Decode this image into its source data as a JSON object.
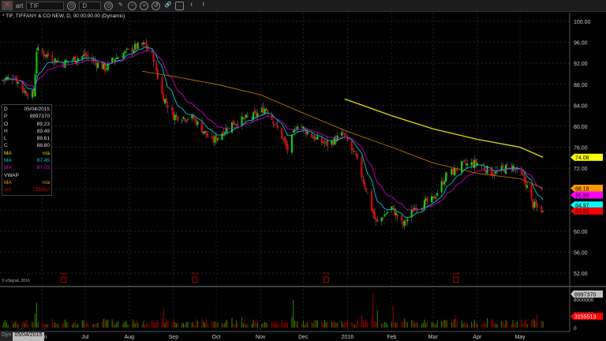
{
  "toolbar": {
    "close_icon": "close-x-icon",
    "label": "art",
    "symbol": "TIF",
    "interval": "D",
    "icons": [
      "clock-icon",
      "clock-icon",
      "pencil-icon",
      "zoom-out-icon",
      "zoom-in-icon",
      "reset-icon",
      "link-icon",
      "square-icon",
      "twitter-icon",
      "facebook-icon"
    ]
  },
  "title": "* TIF, TIFFANY & CO NEW, D, 00:00:00.00 (Dynamic)",
  "infobox": [
    {
      "k": "D",
      "v": "05/04/2015",
      "color": "#dddddd"
    },
    {
      "k": "P",
      "v": "8997370",
      "color": "#dddddd"
    },
    {
      "k": "O",
      "v": "89.23",
      "color": "#dddddd"
    },
    {
      "k": "H",
      "v": "89.49",
      "color": "#dddddd"
    },
    {
      "k": "L",
      "v": "88.61",
      "color": "#dddddd"
    },
    {
      "k": "C",
      "v": "88.80",
      "color": "#dddddd"
    },
    {
      "k": "MA",
      "v": "n/a",
      "color": "#e0e000"
    },
    {
      "k": "MA",
      "v": "87.45",
      "color": "#00d0d0"
    },
    {
      "k": "MA",
      "v": "87.03",
      "color": "#e000e0"
    },
    {
      "k": "VWAP",
      "v": "",
      "color": "#dddddd"
    },
    {
      "k": "MA",
      "v": "n/a",
      "color": "#ff9900"
    },
    {
      "k": "Vol",
      "v": "795662",
      "color": "#cc0000"
    }
  ],
  "copyright": "© eSignal, 2016",
  "colors": {
    "up": "#00dd00",
    "down": "#ee0000",
    "ma_fast": "#00c8c8",
    "ma_mid": "#c000c0",
    "ma_slow": "#b86e00",
    "ma_long": "#e0e000"
  },
  "chart_data": {
    "type": "candlestick",
    "ylim": [
      50,
      101
    ],
    "y_ticks": [
      "100.00",
      "96.00",
      "92.00",
      "88.00",
      "84.00",
      "80.00",
      "76.00",
      "72.00",
      "68.00",
      "64.00",
      "60.00",
      "56.00",
      "52.00"
    ],
    "x_ticks": [
      "Jun",
      "Jul",
      "Aug",
      "Sep",
      "Oct",
      "Nov",
      "Dec",
      "2016",
      "Feb",
      "Mar",
      "Apr",
      "May"
    ],
    "start": "2015-05-04",
    "end": "2016-05-17",
    "close_path": [
      [
        "2015-05-04",
        88.8
      ],
      [
        "2015-05-12",
        89.5
      ],
      [
        "2015-05-20",
        86.5
      ],
      [
        "2015-05-26",
        86
      ],
      [
        "2015-05-28",
        94.5
      ],
      [
        "2015-06-15",
        92
      ],
      [
        "2015-07-01",
        93.5
      ],
      [
        "2015-07-15",
        91
      ],
      [
        "2015-07-22",
        93
      ],
      [
        "2015-08-05",
        95
      ],
      [
        "2015-08-12",
        95.5
      ],
      [
        "2015-08-18",
        93
      ],
      [
        "2015-08-24",
        86
      ],
      [
        "2015-09-01",
        82
      ],
      [
        "2015-09-15",
        81.5
      ],
      [
        "2015-09-28",
        77
      ],
      [
        "2015-10-12",
        80.5
      ],
      [
        "2015-10-28",
        82
      ],
      [
        "2015-11-05",
        83.5
      ],
      [
        "2015-11-16",
        78
      ],
      [
        "2015-11-20",
        75.5
      ],
      [
        "2015-11-27",
        80.5
      ],
      [
        "2015-12-10",
        77.5
      ],
      [
        "2015-12-18",
        76.5
      ],
      [
        "2015-12-29",
        78.5
      ],
      [
        "2016-01-07",
        74
      ],
      [
        "2016-01-14",
        68
      ],
      [
        "2016-01-21",
        61.5
      ],
      [
        "2016-02-01",
        64.5
      ],
      [
        "2016-02-09",
        61
      ],
      [
        "2016-02-17",
        64.5
      ],
      [
        "2016-03-01",
        66
      ],
      [
        "2016-03-10",
        70.5
      ],
      [
        "2016-03-21",
        72.5
      ],
      [
        "2016-04-01",
        73
      ],
      [
        "2016-04-12",
        71
      ],
      [
        "2016-04-25",
        72.5
      ],
      [
        "2016-05-04",
        70
      ],
      [
        "2016-05-10",
        65
      ],
      [
        "2016-05-17",
        63.85
      ]
    ],
    "ma_slow_path": [
      [
        "2015-08-10",
        90.5
      ],
      [
        "2015-09-01",
        89.5
      ],
      [
        "2015-10-01",
        88
      ],
      [
        "2015-11-01",
        86
      ],
      [
        "2015-12-01",
        82.5
      ],
      [
        "2016-01-01",
        79
      ],
      [
        "2016-02-01",
        76
      ],
      [
        "2016-03-01",
        73
      ],
      [
        "2016-04-01",
        71
      ],
      [
        "2016-05-01",
        70
      ],
      [
        "2016-05-17",
        68.18
      ]
    ],
    "ma_long_path": [
      [
        "2015-12-30",
        85.2
      ],
      [
        "2016-02-01",
        82
      ],
      [
        "2016-03-01",
        79.5
      ],
      [
        "2016-04-01",
        77.5
      ],
      [
        "2016-05-01",
        76
      ],
      [
        "2016-05-17",
        74.08
      ]
    ],
    "price_markers": [
      {
        "label": "74.08",
        "color": "#ffff00",
        "price": 74.08
      },
      {
        "label": "68.18",
        "color": "#ff9900",
        "price": 68.18
      },
      {
        "label": "66.90",
        "color": "#ff00ff",
        "price": 66.9
      },
      {
        "label": "64.97",
        "color": "#00ffff",
        "price": 64.97
      },
      {
        "label": "63.85",
        "color": "#ff0000",
        "price": 63.85
      }
    ],
    "dividends": [
      {
        "date": "2015-06-16",
        "label": "0.61"
      },
      {
        "date": "2015-09-16",
        "label": "0.61"
      },
      {
        "date": "2015-12-17",
        "label": "0.71"
      },
      {
        "date": "2016-03-17",
        "label": "1.26"
      }
    ],
    "volume": {
      "ylim": [
        0,
        10000000
      ],
      "y_ticks": [
        "8000000",
        "4000000",
        "0"
      ],
      "spikes": [
        [
          "2015-05-28",
          7000000
        ],
        [
          "2015-08-25",
          5300000
        ],
        [
          "2015-11-24",
          7700000
        ],
        [
          "2016-01-19",
          9700000
        ],
        [
          "2016-01-22",
          4800000
        ],
        [
          "2016-02-02",
          6100000
        ],
        [
          "2016-03-17",
          3300000
        ],
        [
          "2016-05-13",
          3600000
        ]
      ],
      "markers": [
        {
          "label": "8997370",
          "color": "#c0c0c0",
          "value": 8997370
        },
        {
          "label": "3155513",
          "color": "#ff0000",
          "value": 3155513
        }
      ]
    }
  },
  "footer": {
    "label": "Dyn",
    "date": "05/04/2015"
  }
}
